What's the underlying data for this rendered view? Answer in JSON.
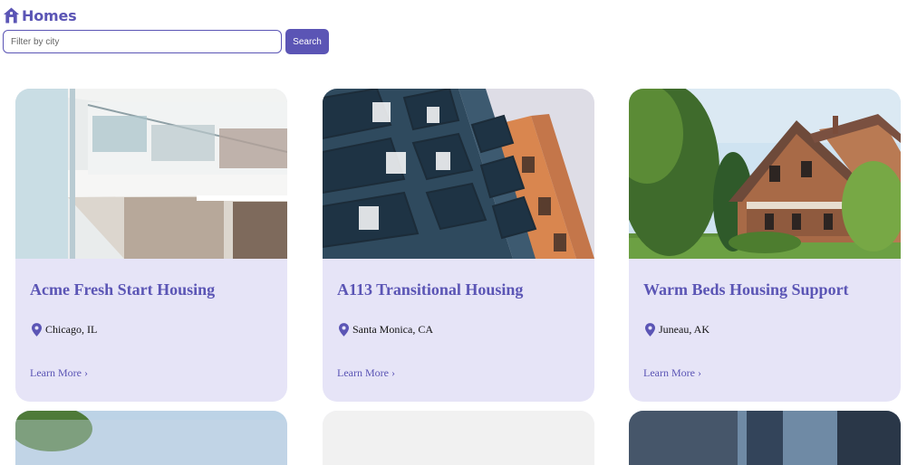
{
  "brand": {
    "title": "Homes",
    "icon": "house-icon"
  },
  "search": {
    "placeholder": "Filter by city",
    "value": "",
    "button_label": "Search"
  },
  "cards": [
    {
      "title": "Acme Fresh Start Housing",
      "location": "Chicago, IL",
      "link": "Learn More ›"
    },
    {
      "title": "A113 Transitional Housing",
      "location": "Santa Monica, CA",
      "link": "Learn More ›"
    },
    {
      "title": "Warm Beds Housing Support",
      "location": "Juneau, AK",
      "link": "Learn More ›"
    }
  ],
  "colors": {
    "accent": "#5b55b5",
    "card_bg": "#e6e4f7",
    "text": "#111111"
  }
}
